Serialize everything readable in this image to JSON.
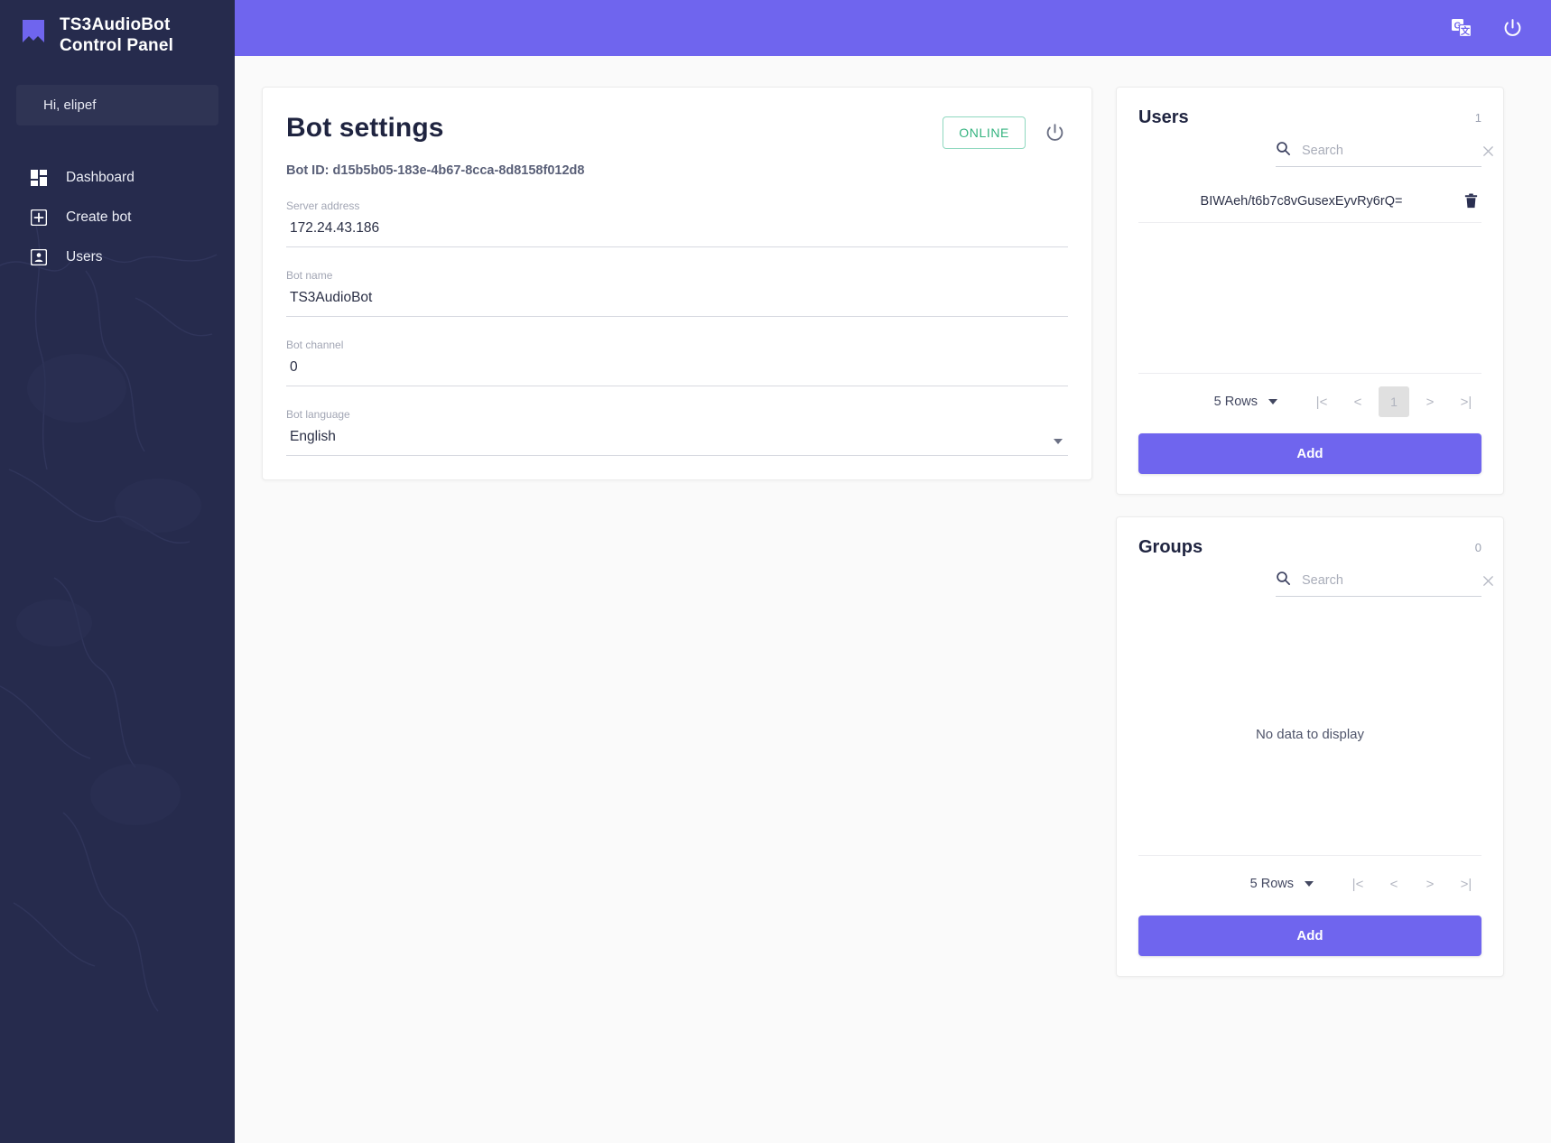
{
  "sidebar": {
    "brand_line1": "TS3AudioBot",
    "brand_line2": "Control Panel",
    "greeting": "Hi, elipef",
    "items": [
      {
        "label": "Dashboard",
        "icon": "dashboard-icon"
      },
      {
        "label": "Create bot",
        "icon": "plus-box-icon"
      },
      {
        "label": "Users",
        "icon": "user-card-icon"
      }
    ]
  },
  "topbar": {
    "translate_icon": "translate-icon",
    "power_icon": "power-icon",
    "background": "#6f65ee"
  },
  "settings": {
    "title": "Bot settings",
    "status_label": "ONLINE",
    "status_color": "#34b37f",
    "power_icon": "power-icon",
    "bot_id": "Bot ID: d15b5b05-183e-4b67-8cca-8d8158f012d8",
    "fields": [
      {
        "label": "Server address",
        "value": "172.24.43.186",
        "type": "text"
      },
      {
        "label": "Bot name",
        "value": "TS3AudioBot",
        "type": "text"
      },
      {
        "label": "Bot channel",
        "value": "0",
        "type": "text"
      },
      {
        "label": "Bot language",
        "value": "English",
        "type": "select"
      }
    ]
  },
  "users_panel": {
    "title": "Users",
    "count": "1",
    "search_placeholder": "Search",
    "search_value": "",
    "rows": [
      {
        "id": "BIWAeh/t6b7c8vGusexEyvRy6rQ=",
        "delete_icon": "trash-icon"
      }
    ],
    "pager": {
      "rows_label": "5 Rows",
      "first_label": "|<",
      "prev_label": "<",
      "page_label": "1",
      "next_label": ">",
      "last_label": ">|"
    },
    "add_label": "Add"
  },
  "groups_panel": {
    "title": "Groups",
    "count": "0",
    "search_placeholder": "Search",
    "search_value": "",
    "empty_text": "No data to display",
    "pager": {
      "rows_label": "5 Rows",
      "first_label": "|<",
      "prev_label": "<",
      "next_label": ">",
      "last_label": ">|"
    },
    "add_label": "Add"
  }
}
